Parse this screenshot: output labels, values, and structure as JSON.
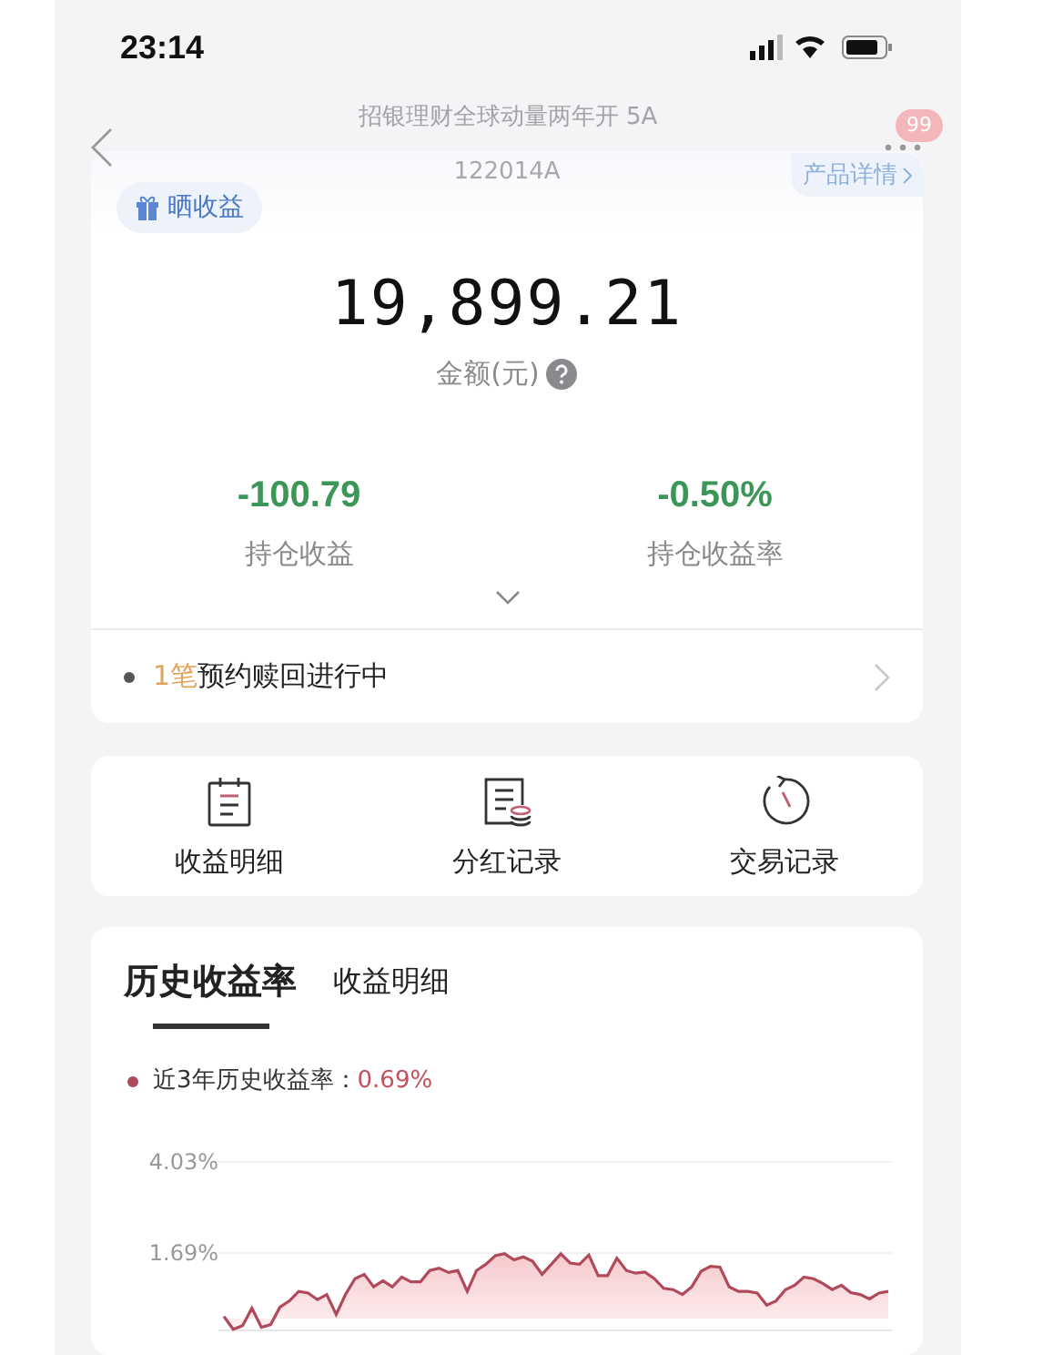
{
  "status_bar": {
    "time": "23:14"
  },
  "nav": {
    "title": "招银理财全球动量两年开 5A",
    "badge": "99"
  },
  "summary": {
    "code": "122014A",
    "share_button": "晒收益",
    "detail_link": "产品详情",
    "amount": "19,899.21",
    "amount_label": "金额(元)",
    "metrics": [
      {
        "value": "-100.79",
        "label": "持仓收益"
      },
      {
        "value": "-0.50%",
        "label": "持仓收益率"
      }
    ]
  },
  "notice": {
    "highlight": "1笔",
    "text": "预约赎回进行中"
  },
  "shortcuts": [
    {
      "kind": "ledger",
      "label": "收益明细"
    },
    {
      "kind": "dividend",
      "label": "分红记录"
    },
    {
      "kind": "history",
      "label": "交易记录"
    }
  ],
  "history": {
    "tabs": [
      {
        "label": "历史收益率",
        "selected": true
      },
      {
        "label": "收益明细",
        "selected": false
      }
    ],
    "legend": {
      "label": "近3年历史收益率：",
      "value": "0.69%"
    },
    "chart_data": {
      "type": "area",
      "ylim": [
        -0.3,
        4.03
      ],
      "yticks": [
        {
          "value": 4.03,
          "label": "4.03%"
        },
        {
          "value": 1.69,
          "label": "1.69%"
        }
      ],
      "series": [
        {
          "color": "#b04a5a",
          "values": [
            0.06,
            -0.27,
            -0.18,
            0.27,
            -0.22,
            -0.15,
            0.3,
            0.46,
            0.7,
            0.66,
            0.49,
            0.62,
            0.11,
            0.62,
            1.03,
            1.14,
            0.82,
            0.98,
            0.82,
            1.07,
            0.95,
            0.95,
            1.24,
            1.3,
            1.19,
            1.24,
            0.7,
            1.24,
            1.4,
            1.62,
            1.67,
            1.51,
            1.59,
            1.48,
            1.14,
            1.4,
            1.67,
            1.43,
            1.4,
            1.64,
            1.11,
            1.11,
            1.56,
            1.24,
            1.17,
            1.2,
            1.03,
            0.78,
            0.75,
            0.62,
            0.82,
            1.22,
            1.35,
            1.33,
            0.82,
            0.7,
            0.7,
            0.66,
            0.35,
            0.46,
            0.75,
            0.86,
            1.07,
            1.03,
            0.91,
            0.75,
            0.86,
            0.67,
            0.62,
            0.51,
            0.66,
            0.7
          ]
        }
      ]
    }
  }
}
